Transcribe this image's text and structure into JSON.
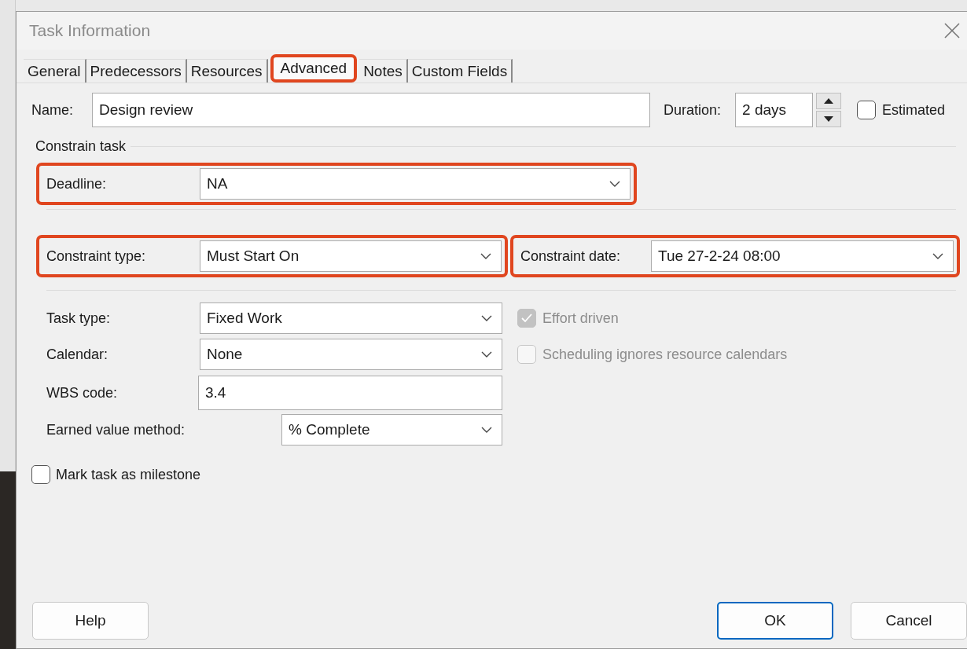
{
  "window": {
    "title": "Task Information"
  },
  "tabs": [
    {
      "label": "General",
      "selected": false,
      "highlighted": false
    },
    {
      "label": "Predecessors",
      "selected": false,
      "highlighted": false
    },
    {
      "label": "Resources",
      "selected": false,
      "highlighted": false
    },
    {
      "label": "Advanced",
      "selected": true,
      "highlighted": true
    },
    {
      "label": "Notes",
      "selected": false,
      "highlighted": false
    },
    {
      "label": "Custom Fields",
      "selected": false,
      "highlighted": false
    }
  ],
  "name": {
    "label": "Name:",
    "value": "Design review"
  },
  "duration": {
    "label": "Duration:",
    "value": "2 days"
  },
  "estimated": {
    "label": "Estimated",
    "checked": false
  },
  "constrain_task": {
    "heading": "Constrain task",
    "deadline": {
      "label": "Deadline:",
      "value": "NA",
      "highlighted": true
    },
    "constraint_type": {
      "label": "Constraint type:",
      "value": "Must Start On",
      "highlighted": true
    },
    "constraint_date": {
      "label": "Constraint date:",
      "value": "Tue 27-2-24 08:00",
      "highlighted": true
    }
  },
  "fields": [
    {
      "kind": "dropdown",
      "label": "Task type:",
      "value": "Fixed Work"
    },
    {
      "kind": "dropdown",
      "label": "Calendar:",
      "value": "None"
    },
    {
      "kind": "text",
      "label": "WBS code:",
      "value": "3.4"
    },
    {
      "kind": "dropdown",
      "label": "Earned value method:",
      "value": "% Complete"
    }
  ],
  "options": [
    {
      "label": "Effort driven",
      "checked": true,
      "disabled": true
    },
    {
      "label": "Scheduling ignores resource calendars",
      "checked": false,
      "disabled": true
    }
  ],
  "milestone": {
    "label": "Mark task as milestone",
    "checked": false
  },
  "buttons": [
    {
      "label": "Help",
      "default": false
    },
    {
      "label": "OK",
      "default": true
    },
    {
      "label": "Cancel",
      "default": false
    }
  ]
}
